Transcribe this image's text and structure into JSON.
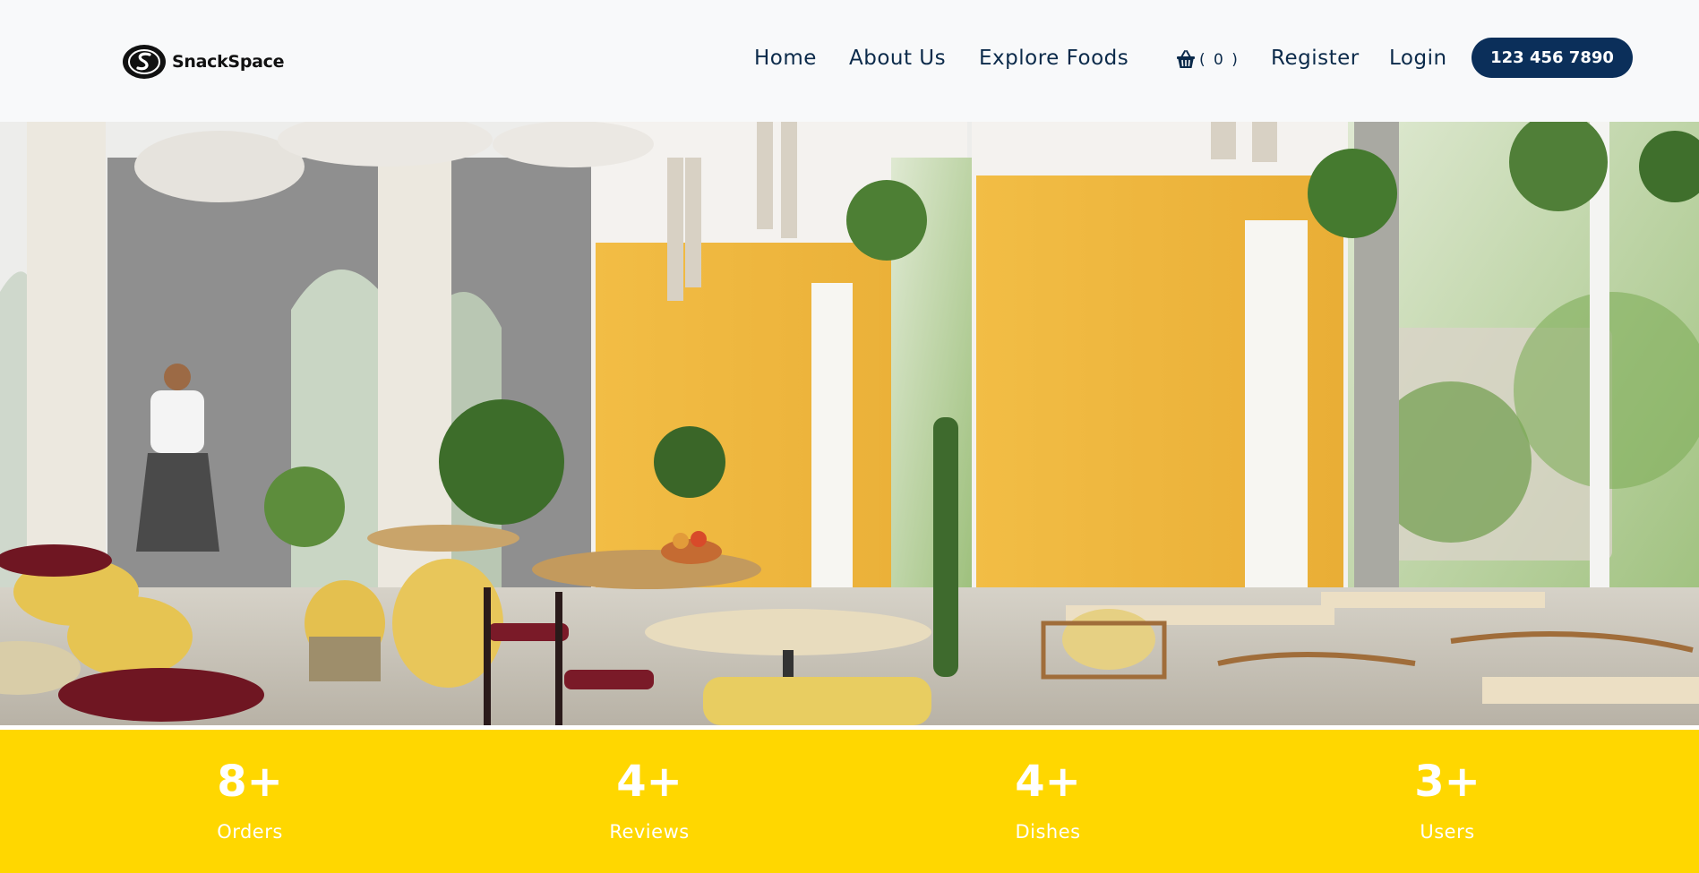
{
  "brand": {
    "name": "SnackSpace",
    "logo_icon": "swirl-s-logo"
  },
  "nav": {
    "items": [
      {
        "label": "Home"
      },
      {
        "label": "About Us"
      },
      {
        "label": "Explore Foods"
      },
      {
        "label": "Register"
      },
      {
        "label": "Login"
      }
    ],
    "cart": {
      "icon": "basket-icon",
      "count_text": "( 0 )"
    },
    "phone_label": "123 456 7890"
  },
  "hero": {
    "image": "restaurant-interior-photo"
  },
  "stats": [
    {
      "value": "8+",
      "label": "Orders"
    },
    {
      "value": "4+",
      "label": "Reviews"
    },
    {
      "value": "4+",
      "label": "Dishes"
    },
    {
      "value": "3+",
      "label": "Users"
    }
  ],
  "colors": {
    "navbar_bg": "#f8f9fa",
    "nav_text": "#0b2a4a",
    "phone_button_bg": "#0b2f5a",
    "stats_bg": "#ffd700",
    "stats_text": "#ffffff"
  }
}
